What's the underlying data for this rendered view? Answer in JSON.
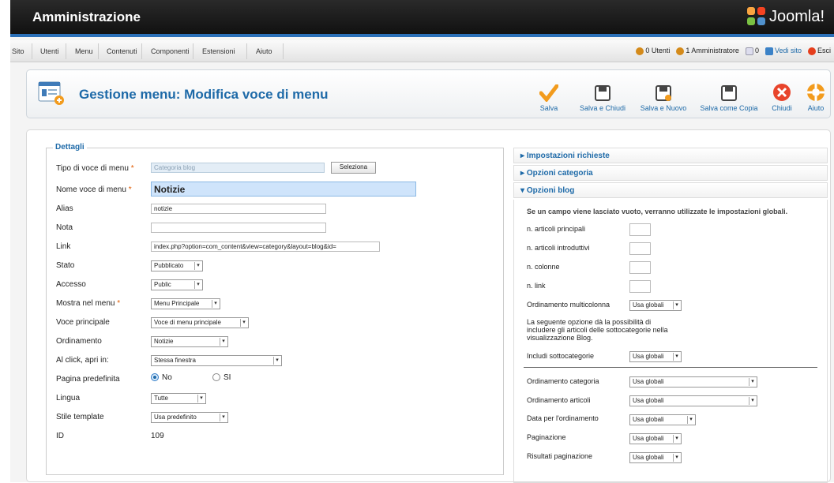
{
  "header": {
    "title": "Amministrazione",
    "brand": "Joomla!"
  },
  "menubar": {
    "items": [
      "Sito",
      "Utenti",
      "Menu",
      "Contenuti",
      "Componenti",
      "Estensioni",
      "Aiuto"
    ],
    "status": {
      "users": "0 Utenti",
      "admins": "1 Amministratore",
      "messages": "0",
      "view_site": "Vedi sito",
      "logout": "Esci"
    }
  },
  "toolbar": {
    "title": "Gestione menu: Modifica voce di menu",
    "buttons": [
      "Salva",
      "Salva e Chiudi",
      "Salva e Nuovo",
      "Salva come Copia",
      "Chiudi",
      "Aiuto"
    ]
  },
  "details": {
    "legend": "Dettagli",
    "type_label": "Tipo di voce di menu",
    "type_value": "Categoria blog",
    "select_button": "Seleziona",
    "name_label": "Nome voce di menu",
    "name_value": "Notizie",
    "alias_label": "Alias",
    "alias_value": "notizie",
    "note_label": "Nota",
    "note_value": "",
    "link_label": "Link",
    "link_value": "index.php?option=com_content&view=category&layout=blog&id=",
    "state_label": "Stato",
    "state_value": "Pubblicato",
    "access_label": "Accesso",
    "access_value": "Public",
    "menu_label": "Mostra nel menu",
    "menu_value": "Menu Principale",
    "parent_label": "Voce principale",
    "parent_value": "Voce di menu principale",
    "order_label": "Ordinamento",
    "order_value": "Notizie",
    "click_label": "Al click, apri in:",
    "click_value": "Stessa finestra",
    "default_label": "Pagina predefinita",
    "default_no": "No",
    "default_yes": "SI",
    "lang_label": "Lingua",
    "lang_value": "Tutte",
    "style_label": "Stile template",
    "style_value": "Usa predefinito",
    "id_label": "ID",
    "id_value": "109"
  },
  "panels": {
    "required": "Impostazioni richieste",
    "category": "Opzioni categoria",
    "blog": "Opzioni blog"
  },
  "blog": {
    "note": "Se un campo viene lasciato vuoto, verranno utilizzate le impostazioni globali.",
    "leading": "n. articoli principali",
    "intro": "n. articoli introduttivi",
    "columns": "n. colonne",
    "links": "n. link",
    "multicolumn_label": "Ordinamento multicolonna",
    "multicolumn_value": "Usa globali",
    "subcat_note_1": "La seguente opzione dà la possibilità di",
    "subcat_note_2": "includere gli articoli delle sottocategorie nella",
    "subcat_note_3": "visualizzazione Blog.",
    "subcat_label": "Includi sottocategorie",
    "subcat_value": "Usa globali",
    "cat_order_label": "Ordinamento categoria",
    "cat_order_value": "Usa globali",
    "art_order_label": "Ordinamento articoli",
    "art_order_value": "Usa globali",
    "date_label": "Data per l'ordinamento",
    "date_value": "Usa globali",
    "pagination_label": "Paginazione",
    "pagination_value": "Usa globali",
    "pag_results_label": "Risultati paginazione",
    "pag_results_value": "Usa globali"
  }
}
